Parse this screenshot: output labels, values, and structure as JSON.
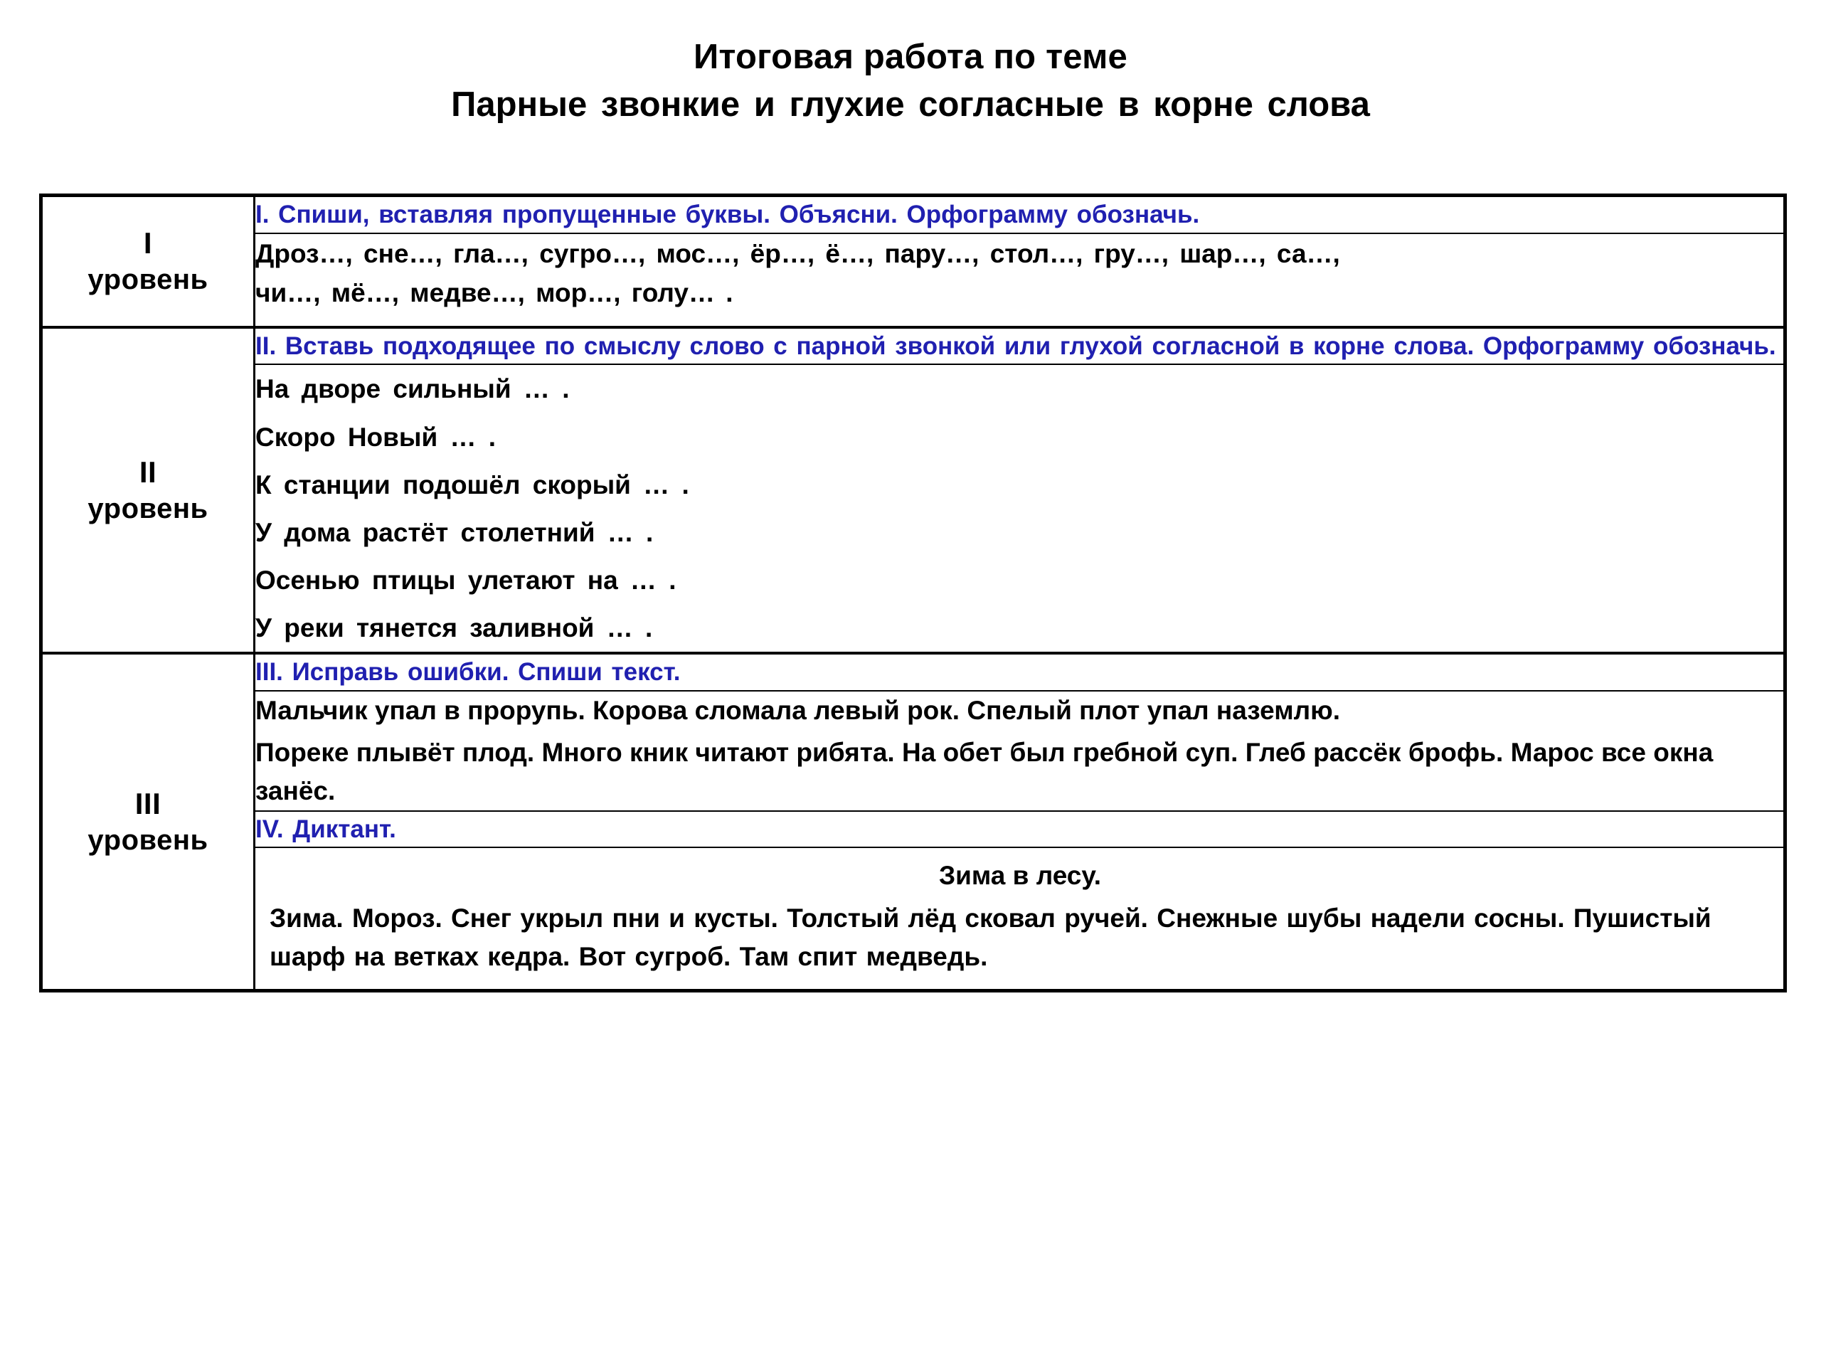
{
  "document": {
    "title": "Итоговая работа по теме",
    "subtitle": "Парные звонкие и глухие согласные в корне слова"
  },
  "levels": {
    "one": {
      "roman": "I",
      "word": "уровень"
    },
    "two": {
      "roman": "II",
      "word": "уровень"
    },
    "three": {
      "roman": "III",
      "word": "уровень"
    }
  },
  "tasks": {
    "task1": {
      "heading": "I. Спиши, вставляя  пропущенные  буквы.  Объясни.  Орфограмму  обозначь.",
      "words_line1": "Дроз…,  сне…,  гла…, сугро…, мос…,  ёр…,  ё…, пару…,  стол…,  гру…,  шар…,   са…,",
      "words_line2": "чи…,  мё…, медве…,  мор…,  голу… ."
    },
    "task2": {
      "heading": "II. Вставь подходящее по смыслу слово с парной звонкой или глухой согласной  в корне слова. Орфограмму обозначь.",
      "sentences": [
        "На  дворе  сильный  … .",
        "Скоро  Новый  … .",
        "К  станции  подошёл  скорый  … .",
        "У  дома  растёт  столетний   … .",
        "Осенью  птицы  улетают  на   … .",
        "У  реки  тянется  заливной   … ."
      ]
    },
    "task3": {
      "heading": "III.  Исправь ошибки. Спиши текст.",
      "paragraph1": "Мальчик упал в прорупь. Корова сломала левый рок. Спелый плот упал наземлю.",
      "paragraph2": "Пореке  плывёт  плод.  Много  кник  читают рибята. На обет был гребной суп. Глеб рассёк  брофь. Марос все окна занёс."
    },
    "task4": {
      "heading": "IV. Диктант.",
      "text_title": "Зима в лесу.",
      "text_body": "Зима. Мороз. Снег укрыл пни и кусты. Толстый лёд сковал ручей. Снежные шубы надели сосны.  Пушистый  шарф на  ветках  кедра.  Вот сугроб. Там спит медведь."
    }
  },
  "colors": {
    "heading_blue": "#2020b0",
    "text_black": "#000000",
    "border_black": "#000000",
    "background": "#ffffff"
  }
}
